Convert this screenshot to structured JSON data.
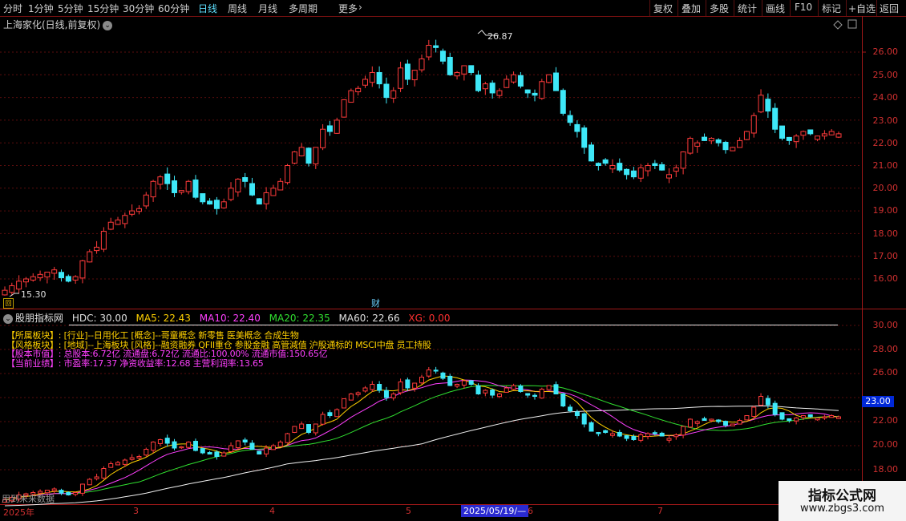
{
  "toolbar": {
    "periods": [
      "分时",
      "1分钟",
      "5分钟",
      "15分钟",
      "30分钟",
      "60分钟",
      "日线",
      "周线",
      "月线",
      "多周期",
      "更多"
    ],
    "active_period": "日线",
    "right_buttons": [
      "复权",
      "叠加",
      "多股",
      "统计",
      "画线",
      "F10",
      "标记",
      "+自选",
      "返回"
    ]
  },
  "stock": {
    "title": "上海家化(日线,前复权)"
  },
  "price_axis": [
    "26.00",
    "25.00",
    "24.00",
    "23.00",
    "22.00",
    "21.00",
    "20.00",
    "19.00",
    "18.00",
    "17.00",
    "16.00"
  ],
  "annotations": {
    "high": "26.87",
    "low": "15.30",
    "cai": "财"
  },
  "indicator_header": {
    "name": "股朋指标网",
    "hdc": "HDC: 30.00",
    "ma5": "MA5: 22.43",
    "ma10": "MA10: 22.40",
    "ma20": "MA20: 22.35",
    "ma60": "MA60: 22.66",
    "xg": "XG: 0.00"
  },
  "info_lines": [
    "【所属板块】: [行业]--日用化工 [概念]--哥童概念 新零售 医美概念 合成生物",
    "【风格板块】: [地域]--上海板块 [风格]--融资融券 QFII重仓 参股金融 高管減值 沪股通标的 MSCI中盘 员工持股",
    "【股本市值】: 总股本:6.72亿 流通盘:6.72亿 流通比:100.00% 流通市值:150.65亿",
    "【当前业绩】: 市盈率:17.37 净资收益率:12.68 主营利润率:13.65"
  ],
  "lower_axis": [
    "30.00",
    "28.00",
    "26.00",
    "24.00",
    "22.00",
    "20.00",
    "18.00"
  ],
  "current_value_badge": "23.00",
  "x_labels": [
    "2025年",
    "3",
    "4",
    "5",
    "6",
    "7"
  ],
  "cursor_date": "2025/05/19/—",
  "future_data_label": "用到未来数据",
  "watermark": {
    "title": "指标公式网",
    "url": "www.zbgs3.com"
  },
  "colors": {
    "up": "#ff3b3b",
    "down": "#3ee8f8",
    "ma5": "#f0f0f0",
    "ma10": "#ffd000",
    "ma20": "#ff40ff",
    "ma60": "#30e030",
    "axis": "#d03030"
  },
  "chart_data": {
    "type": "candlestick",
    "indicator_lines": {
      "HDC": 30.0,
      "MA5": 22.43,
      "MA10": 22.4,
      "MA20": 22.35,
      "MA60": 22.66
    },
    "closes": [
      15.5,
      15.7,
      15.9,
      16.0,
      16.1,
      16.2,
      16.3,
      16.4,
      16.05,
      15.9,
      16.1,
      16.8,
      17.2,
      17.4,
      18.1,
      18.5,
      18.6,
      18.8,
      19.0,
      19.1,
      19.7,
      20.3,
      20.5,
      20.2,
      19.8,
      19.9,
      20.3,
      19.6,
      19.4,
      19.3,
      19.1,
      19.4,
      20.0,
      20.4,
      20.3,
      19.7,
      19.3,
      19.8,
      20.0,
      20.3,
      21.0,
      21.6,
      21.8,
      21.1,
      21.8,
      22.6,
      22.5,
      23.0,
      23.9,
      24.3,
      24.4,
      24.8,
      25.1,
      24.6,
      24.0,
      24.3,
      25.3,
      24.8,
      25.2,
      25.7,
      26.3,
      26.2,
      25.6,
      25.0,
      25.1,
      25.4,
      25.1,
      24.3,
      24.6,
      24.2,
      24.3,
      24.8,
      25.0,
      24.5,
      24.2,
      24.1,
      24.7,
      25.0,
      24.3,
      23.3,
      22.9,
      22.5,
      21.8,
      21.2,
      21.0,
      21.1,
      21.0,
      20.8,
      20.6,
      20.5,
      20.9,
      21.0,
      21.0,
      20.8,
      20.6,
      20.9,
      21.6,
      22.2,
      22.0,
      22.1,
      22.2,
      22.0,
      21.7,
      21.8,
      22.1,
      22.5,
      23.2,
      24.1,
      23.4,
      22.6,
      22.2,
      22.1,
      22.3,
      22.5,
      22.4,
      22.3,
      22.4,
      22.5,
      22.4
    ]
  }
}
